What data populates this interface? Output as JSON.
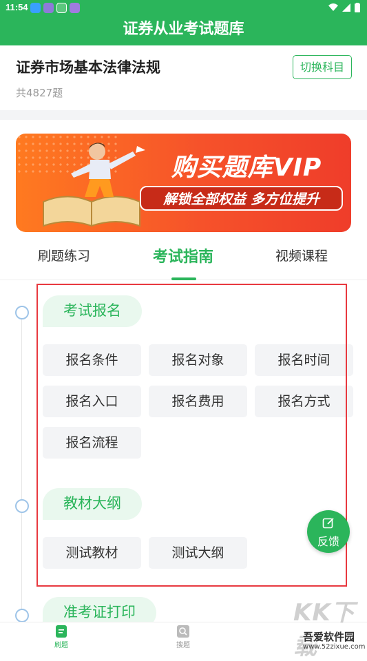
{
  "status_bar": {
    "time": "11:54"
  },
  "app_bar": {
    "title": "证券从业考试题库"
  },
  "subject": {
    "title": "证券市场基本法律法规",
    "count": "共4827题",
    "switch_label": "切换科目"
  },
  "banner": {
    "title": "购买题库VIP",
    "subtitle": "解锁全部权益 多方位提升"
  },
  "tabs": [
    {
      "label": "刷题练习",
      "active": false
    },
    {
      "label": "考试指南",
      "active": true
    },
    {
      "label": "视频课程",
      "active": false
    }
  ],
  "sections": [
    {
      "title": "考试报名",
      "items": [
        "报名条件",
        "报名对象",
        "报名时间",
        "报名入口",
        "报名费用",
        "报名方式",
        "报名流程"
      ]
    },
    {
      "title": "教材大纲",
      "items": [
        "测试教材",
        "测试大纲"
      ]
    },
    {
      "title": "准考证打印",
      "items": []
    }
  ],
  "feedback": {
    "label": "反馈"
  },
  "bottom_nav": [
    {
      "label": "刷题",
      "icon": "document-icon",
      "active": true
    },
    {
      "label": "搜题",
      "icon": "search-icon",
      "active": false
    }
  ],
  "watermark": {
    "logo": "KK下载",
    "name": "吾爱软件园",
    "url": "www.52zixue.com"
  },
  "colors": {
    "primary": "#2bb55b",
    "highlight_frame": "#e8393f",
    "banner": "#f6522a"
  }
}
